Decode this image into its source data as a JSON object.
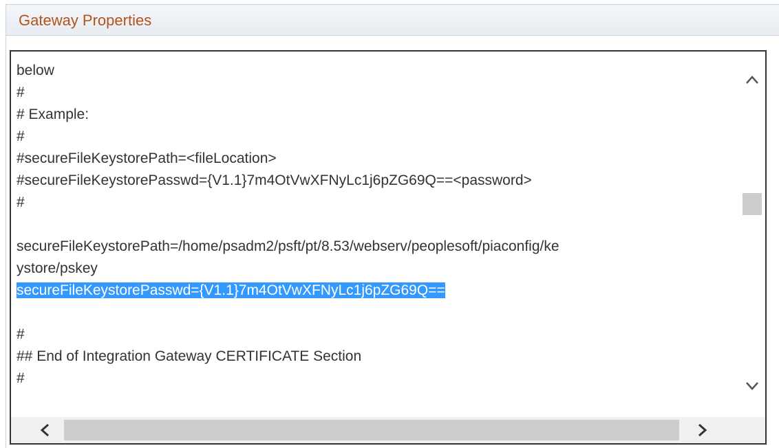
{
  "group": {
    "title": "Gateway Properties"
  },
  "textarea": {
    "lines": [
      "below",
      "#",
      "# Example:",
      "#",
      "#secureFileKeystorePath=<fileLocation>",
      "#secureFileKeystorePasswd={V1.1}7m4OtVwXFNyLc1j6pZG69Q==<password>",
      "#",
      "",
      "secureFileKeystorePath=/home/psadm2/psft/pt/8.53/webserv/peoplesoft/piaconfig/ke",
      "ystore/pskey",
      "secureFileKeystorePasswd={V1.1}7m4OtVwXFNyLc1j6pZG69Q==",
      "",
      "#",
      "## End of Integration Gateway CERTIFICATE Section",
      "#"
    ],
    "selected_line_index": 10
  },
  "scrollbars": {
    "vertical_position_fraction": 0.42,
    "horizontal_position_fraction": 0.5
  },
  "icons": {
    "scroll_up": "chevron-up-icon",
    "scroll_down": "chevron-down-icon",
    "scroll_left": "chevron-left-icon",
    "scroll_right": "chevron-right-icon"
  },
  "colors": {
    "title": "#b4531c",
    "selection": "#3399ff",
    "text": "#333333"
  }
}
